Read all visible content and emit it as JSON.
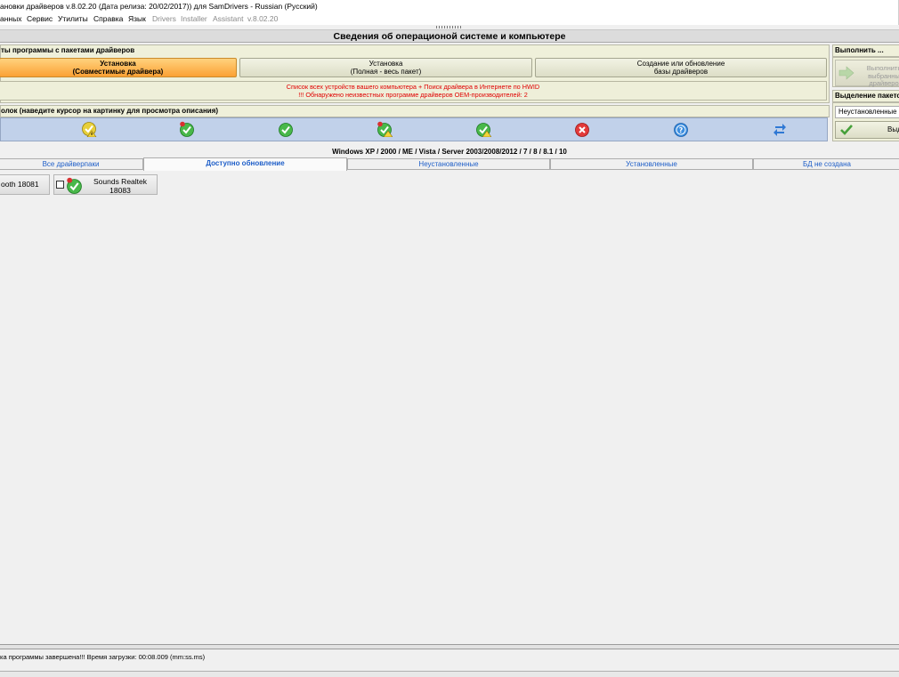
{
  "window": {
    "title": "ановки драйверов v.8.02.20 (Дата релиза: 20/02/2017)) для SamDrivers - Russian (Русский)"
  },
  "menu": {
    "items": [
      "анных",
      "Сервис",
      "Утилиты",
      "Справка",
      "Язык"
    ],
    "dim_items": [
      "Drivers",
      "Installer",
      "Assistant",
      "v.8.02.20"
    ]
  },
  "header": {
    "title": "Сведения об операционой системе и компьютере"
  },
  "modes": {
    "title": "ты программы с пакетами драйверов",
    "buttons": [
      {
        "line1": "Установка",
        "line2": "(Совместимые драйвера)",
        "active": true
      },
      {
        "line1": "Установка",
        "line2": "(Полная - весь пакет)",
        "active": false
      },
      {
        "line1": "Создание или обновление",
        "line2": "базы драйверов",
        "active": false
      }
    ],
    "info_line1": "Список всех устройств вашего компьютера + Поиск драйвера в Интернете по HWID",
    "info_line2": "!!! Обнаружено неизвестных программе драйверов OEM-производителей: 2"
  },
  "filters": {
    "title": "олок (наведите курсор на картинку для просмотра описания)",
    "icons": [
      "warning-check-icon",
      "new-check-icon",
      "check-icon",
      "new-warning-check-icon",
      "warning-check-icon-2",
      "error-icon",
      "help-icon",
      "refresh-arrows-icon"
    ]
  },
  "right_panel": {
    "execute_title": "Выполнить ...",
    "execute_line1": "Выполнить",
    "execute_line2": "выбранны",
    "execute_line3": "драйверо",
    "select_title": "Выделение пакето",
    "select_value": "Неустановленные",
    "select_button": "Выд"
  },
  "os_label": "Windows XP / 2000 / ME / Vista / Server 2003/2008/2012 / 7 / 8 / 8.1 / 10",
  "tabs": [
    {
      "label": "Все драйверпаки",
      "selected": false
    },
    {
      "label": "Доступно обновление",
      "selected": true
    },
    {
      "label": "Неустановленные",
      "selected": false
    },
    {
      "label": "Установленные",
      "selected": false
    },
    {
      "label": "БД не создана",
      "selected": false
    }
  ],
  "packages": [
    {
      "label": "ooth 18081",
      "checked": false
    },
    {
      "label_line1": "Sounds Realtek",
      "label_line2": "18083",
      "checked": false
    }
  ],
  "status": "ка программы завершена!!! Время загрузки: 00:08.009 (mm:ss.ms)",
  "colors": {
    "accent_orange": "#fba134",
    "panel_bg": "#eff0da",
    "icon_bar_bg": "#c1d1ea",
    "tab_text": "#1e5ec8",
    "warning_red": "#e00000"
  }
}
